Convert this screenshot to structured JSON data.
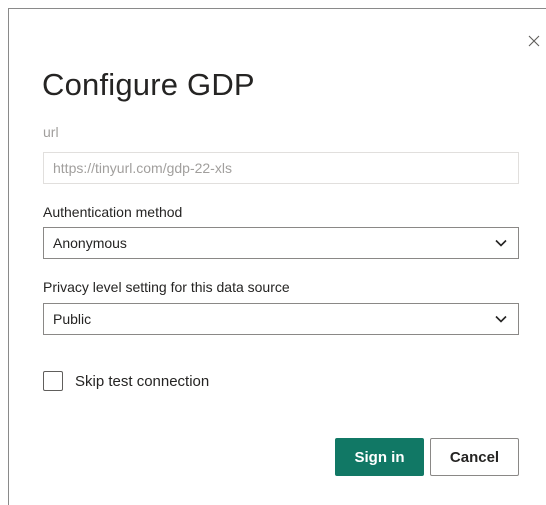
{
  "dialog": {
    "title": "Configure GDP",
    "close_icon": "close-icon"
  },
  "url": {
    "label": "url",
    "placeholder": "https://tinyurl.com/gdp-22-xls"
  },
  "authentication": {
    "label": "Authentication method",
    "selected": "Anonymous",
    "icon": "chevron-down-icon"
  },
  "privacy": {
    "label": "Privacy level setting for this data source",
    "selected": "Public",
    "icon": "chevron-down-icon"
  },
  "skip_test": {
    "label": "Skip test connection",
    "checked": false
  },
  "buttons": {
    "sign_in": "Sign in",
    "cancel": "Cancel"
  },
  "colors": {
    "primary": "#117865",
    "text": "#252423",
    "disabled_text": "#a19f9d"
  }
}
